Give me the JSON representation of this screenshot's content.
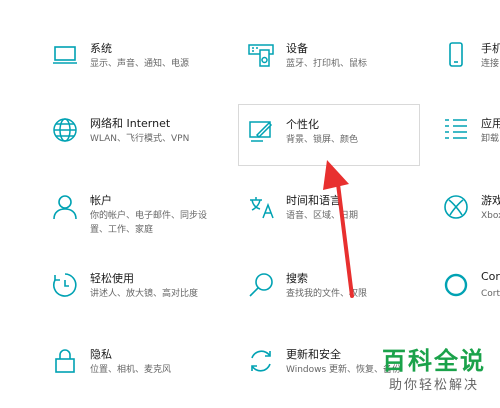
{
  "colors": {
    "accent": "#00a2b3",
    "arrow": "#e8302f",
    "watermark": "#1aa24a"
  },
  "tiles": [
    {
      "title": "系统",
      "desc": "显示、声音、通知、电源",
      "icon": "monitor-icon"
    },
    {
      "title": "设备",
      "desc": "蓝牙、打印机、鼠标",
      "icon": "keyboard-speaker-icon"
    },
    {
      "title": "手机",
      "desc": "连接",
      "icon": "phone-icon"
    },
    {
      "title": "网络和 Internet",
      "desc": "WLAN、飞行模式、VPN",
      "icon": "globe-icon"
    },
    {
      "title": "个性化",
      "desc": "背景、锁屏、颜色",
      "icon": "paint-icon"
    },
    {
      "title": "应用",
      "desc": "卸载",
      "icon": "apps-list-icon"
    },
    {
      "title": "帐户",
      "desc": "你的帐户、电子邮件、同步设\n置、工作、家庭",
      "icon": "person-icon"
    },
    {
      "title": "时间和语言",
      "desc": "语音、区域、日期",
      "icon": "language-icon"
    },
    {
      "title": "游戏",
      "desc": "Xbox",
      "icon": "xbox-icon"
    },
    {
      "title": "轻松使用",
      "desc": "讲述人、放大镜、高对比度",
      "icon": "ease-of-access-icon"
    },
    {
      "title": "搜索",
      "desc": "查找我的文件、权限",
      "icon": "search-icon"
    },
    {
      "title": "Cortana",
      "desc": "Cortana",
      "icon": "cortana-icon"
    },
    {
      "title": "隐私",
      "desc": "位置、相机、麦克风",
      "icon": "lock-icon"
    },
    {
      "title": "更新和安全",
      "desc": "Windows 更新、恢复、备份",
      "icon": "update-icon"
    }
  ],
  "watermark": {
    "title": "百科全说",
    "subtitle": "助你轻松解决"
  }
}
